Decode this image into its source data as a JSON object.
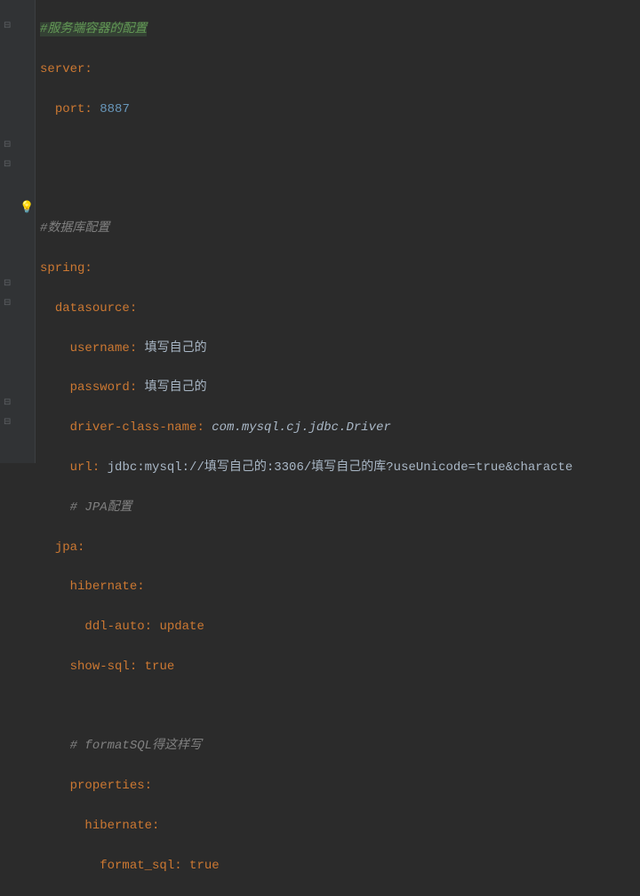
{
  "code": {
    "line1_comment": "#服务端容器的配置",
    "line2_key": "server",
    "line3_key": "port",
    "line3_val": "8887",
    "line6_comment": "#数据库配置",
    "line7_key": "spring",
    "line8_key": "datasource",
    "line9_key": "username",
    "line9_val": "填写自己的",
    "line10_key": "password",
    "line10_val": "填写自己的",
    "line11_key": "driver-class-name",
    "line11_val": "com.mysql.cj.jdbc.Driver",
    "line12_key": "url",
    "line12_val": "jdbc:mysql://填写自己的:3306/填写自己的库?useUnicode=true&characte",
    "line13_comment": "# JPA配置",
    "line14_key": "jpa",
    "line15_key": "hibernate",
    "line16_key": "ddl-auto",
    "line16_val": "update",
    "line17_key": "show-sql",
    "line17_val": "true",
    "line19_comment": "# formatSQL得这样写",
    "line20_key": "properties",
    "line21_key": "hibernate",
    "line22_key": "format_sql",
    "line22_val": "true",
    "colon": ":"
  },
  "gutter": {
    "bulb": "💡"
  }
}
